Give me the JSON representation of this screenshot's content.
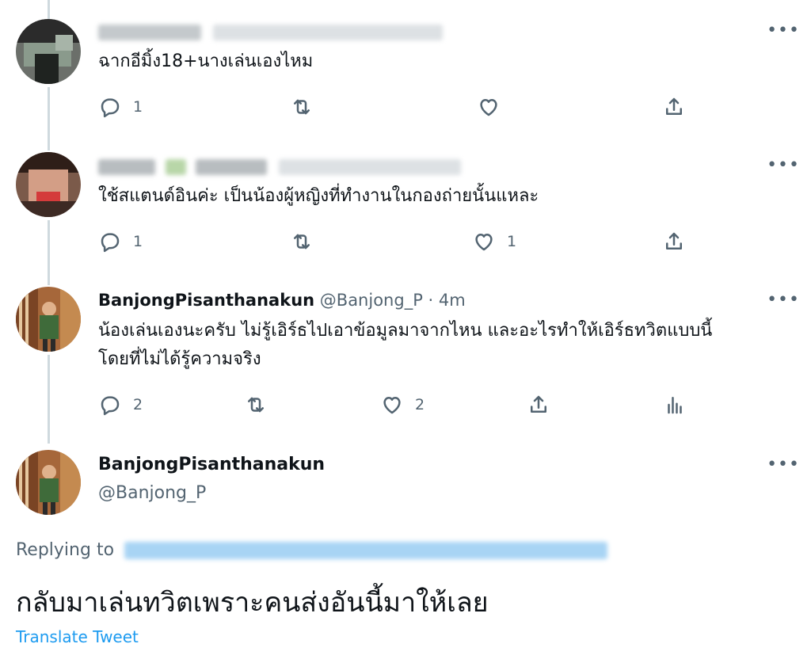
{
  "colors": {
    "accent": "#1d9bf0",
    "muted": "#536471",
    "text": "#0f1419",
    "thread_line": "#cfd9de"
  },
  "replies": [
    {
      "display_name": "",
      "handle": "",
      "text": "ฉากอีมิ้ง18+นางเล่นเองไหม",
      "more_label": "•••",
      "counts": {
        "reply": "1",
        "retweet": "",
        "like": "",
        "share": ""
      }
    },
    {
      "display_name": "",
      "handle": "",
      "text": "ใช้สแตนด์อินค่ะ เป็นน้องผู้หญิงที่ทำงานในกองถ่ายนั้นแหละ",
      "more_label": "•••",
      "counts": {
        "reply": "1",
        "retweet": "",
        "like": "1",
        "share": ""
      }
    },
    {
      "display_name": "BanjongPisanthanakun",
      "handle": "@Banjong_P",
      "time": "· 4m",
      "text_line1": "น้องเล่นเองนะครับ ไม่รู้เอิร์ธไปเอาข้อมูลมาจากไหน และอะไรทำให้เอิร์ธทวิตแบบนี้",
      "text_line2": "โดยที่ไม่ได้รู้ความจริง",
      "more_label": "•••",
      "counts": {
        "reply": "2",
        "retweet": "",
        "like": "2",
        "share": ""
      }
    }
  ],
  "main_tweet": {
    "display_name": "BanjongPisanthanakun",
    "handle": "@Banjong_P",
    "more_label": "•••",
    "replying_prefix": "Replying to",
    "text": "กลับมาเล่นทวิตเพราะคนส่งอันนี้มาให้เลย",
    "translate_label": "Translate Tweet"
  },
  "icons": [
    "reply-icon",
    "retweet-icon",
    "like-icon",
    "share-icon",
    "analytics-icon",
    "more-icon"
  ]
}
